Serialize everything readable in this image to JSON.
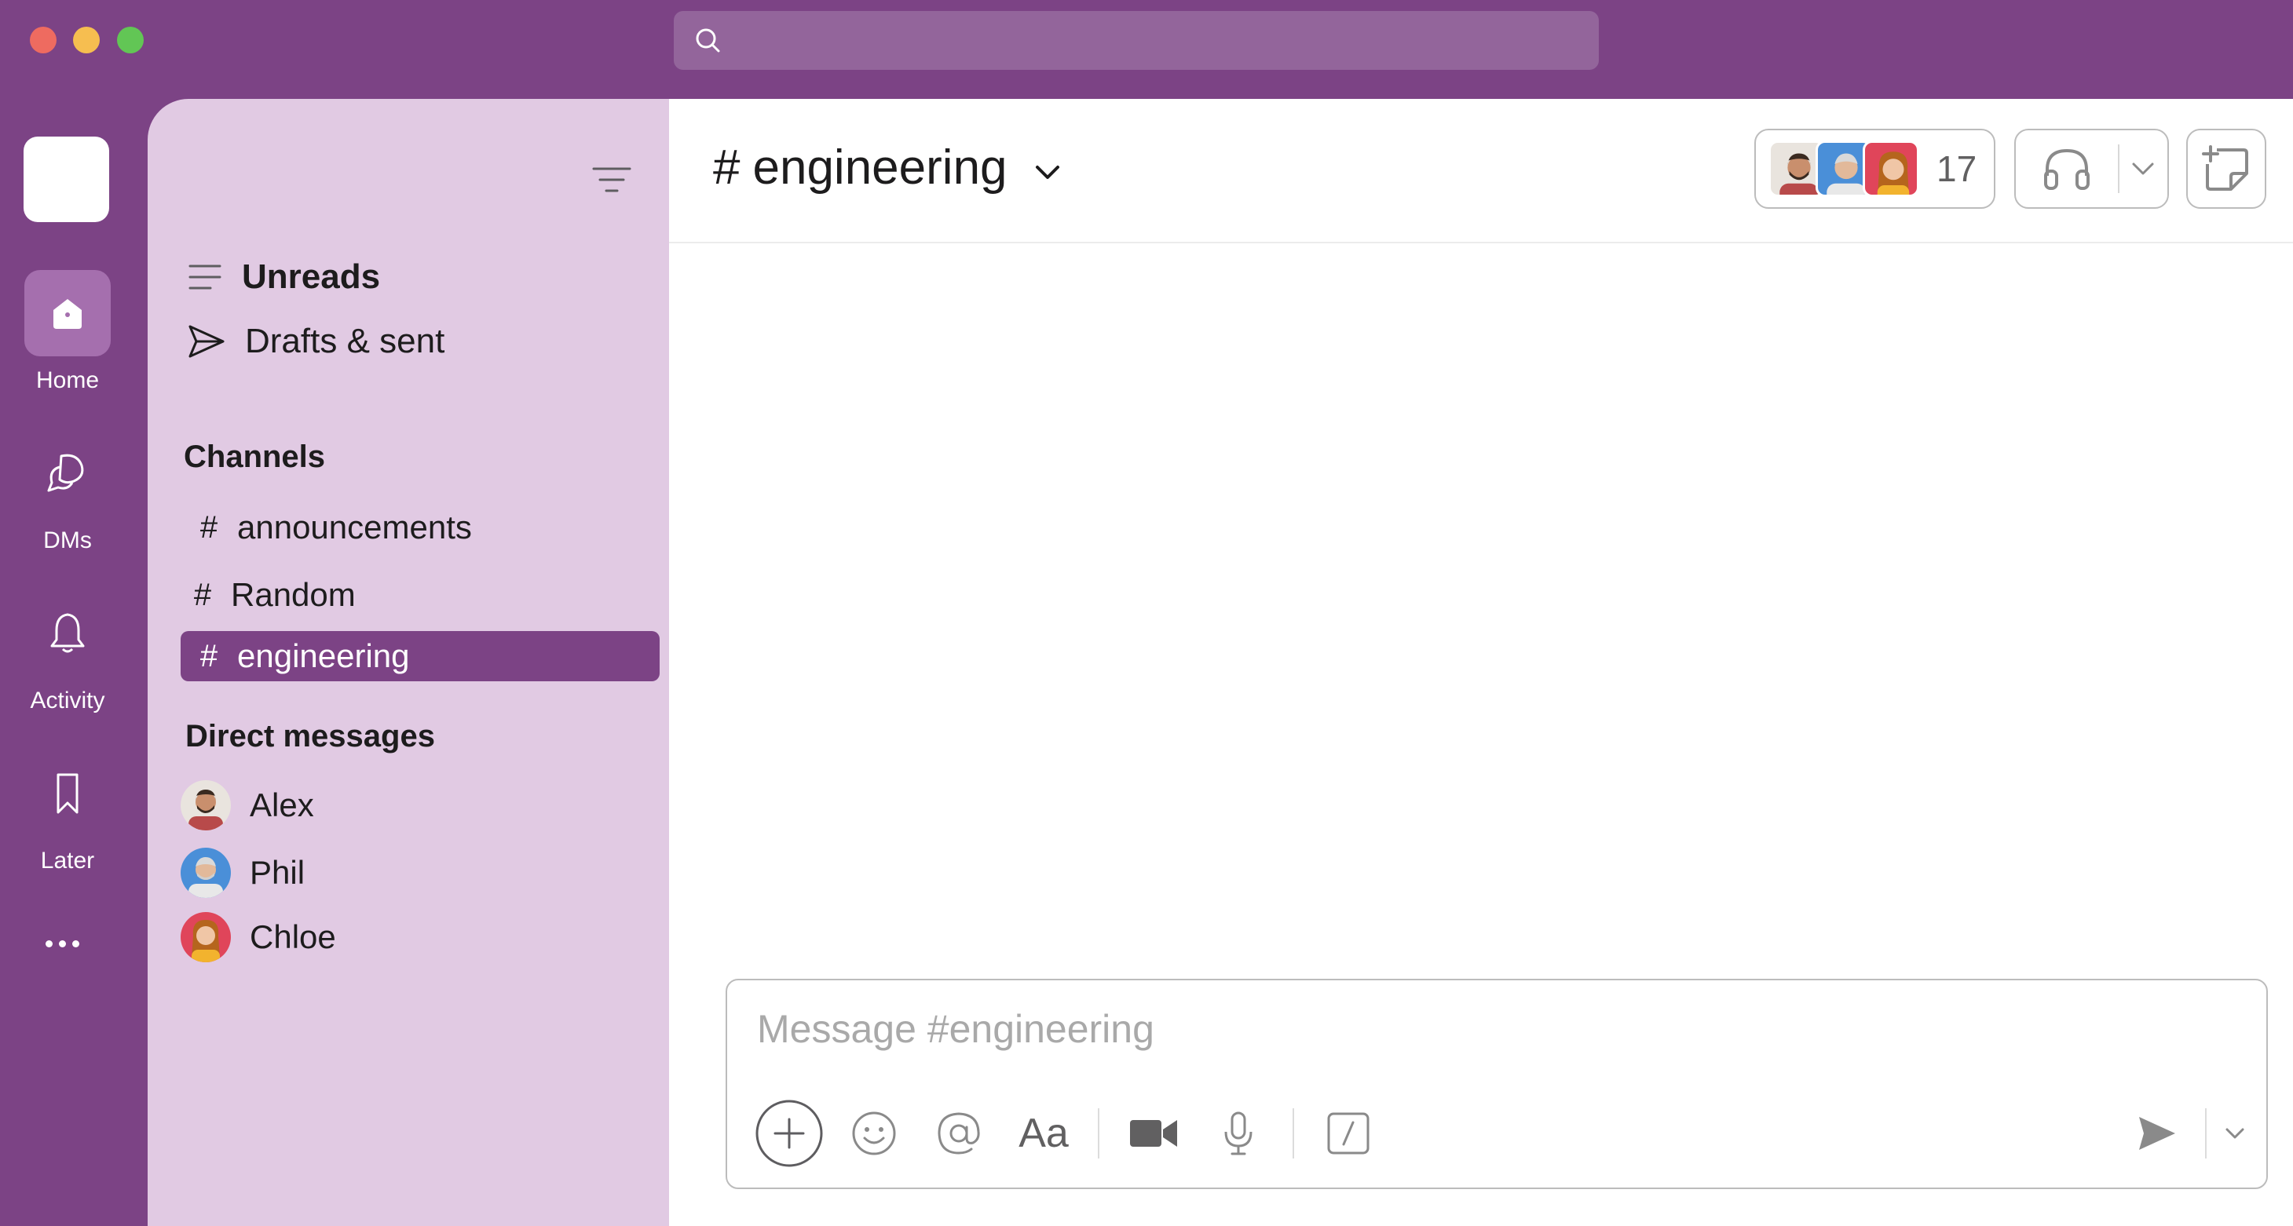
{
  "search": {
    "placeholder": ""
  },
  "rail": {
    "items": [
      {
        "label": "Home",
        "icon": "home-icon",
        "active": true
      },
      {
        "label": "DMs",
        "icon": "dms-icon"
      },
      {
        "label": "Activity",
        "icon": "bell-icon"
      },
      {
        "label": "Later",
        "icon": "bookmark-icon"
      }
    ],
    "more_icon": "more-icon"
  },
  "sidebar": {
    "nav": [
      {
        "label": "Unreads",
        "icon": "unreads-icon"
      },
      {
        "label": "Drafts & sent",
        "icon": "send-icon"
      }
    ],
    "channels_title": "Channels",
    "channels": [
      {
        "hash": "#",
        "name": "announcements"
      },
      {
        "hash": "#",
        "name": "Random"
      },
      {
        "hash": "#",
        "name": "engineering",
        "active": true
      }
    ],
    "dms_title": "Direct messages",
    "dms": [
      {
        "name": "Alex",
        "avatar_color": "#e9e4de"
      },
      {
        "name": "Phil",
        "avatar_color": "#4a8fd8"
      },
      {
        "name": "Chloe",
        "avatar_color": "#e0455a"
      }
    ]
  },
  "header": {
    "hash": "#",
    "channel_name": "engineering",
    "members_count": "17"
  },
  "composer": {
    "placeholder": "Message #engineering",
    "format_label": "Aa"
  },
  "colors": {
    "brand": "#7c4385",
    "sidebar": "#e1cae3",
    "active_channel": "#7c4385"
  }
}
